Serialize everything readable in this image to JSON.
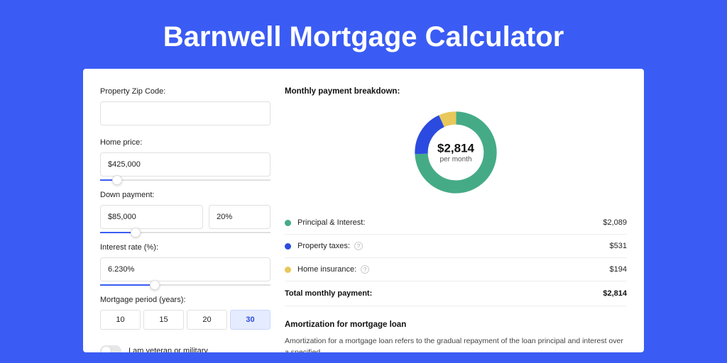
{
  "page": {
    "title": "Barnwell Mortgage Calculator"
  },
  "form": {
    "zip": {
      "label": "Property Zip Code:",
      "value": ""
    },
    "price": {
      "label": "Home price:",
      "value": "$425,000",
      "slider_pct": 10
    },
    "down": {
      "label": "Down payment:",
      "amount": "$85,000",
      "percent": "20%",
      "slider_pct": 21
    },
    "rate": {
      "label": "Interest rate (%):",
      "value": "6.230%",
      "slider_pct": 32
    },
    "period": {
      "label": "Mortgage period (years):",
      "options": [
        "10",
        "15",
        "20",
        "30"
      ],
      "selected": "30"
    },
    "veteran": {
      "label": "I am veteran or military",
      "on": false
    }
  },
  "breakdown": {
    "title": "Monthly payment breakdown:",
    "donut": {
      "value": "$2,814",
      "sub": "per month"
    },
    "rows": [
      {
        "label": "Principal & Interest:",
        "amount": "$2,089",
        "color": "#45ab87",
        "info": false
      },
      {
        "label": "Property taxes:",
        "amount": "$531",
        "color": "#2b4be0",
        "info": true
      },
      {
        "label": "Home insurance:",
        "amount": "$194",
        "color": "#e8c85a",
        "info": true
      }
    ],
    "total": {
      "label": "Total monthly payment:",
      "amount": "$2,814"
    }
  },
  "amort": {
    "title": "Amortization for mortgage loan",
    "text": "Amortization for a mortgage loan refers to the gradual repayment of the loan principal and interest over a specified"
  },
  "chart_data": {
    "type": "pie",
    "title": "Monthly payment breakdown",
    "series": [
      {
        "name": "Principal & Interest",
        "value": 2089,
        "color": "#45ab87"
      },
      {
        "name": "Property taxes",
        "value": 531,
        "color": "#2b4be0"
      },
      {
        "name": "Home insurance",
        "value": 194,
        "color": "#e8c85a"
      }
    ],
    "total": 2814,
    "center_label": "$2,814 per month"
  }
}
